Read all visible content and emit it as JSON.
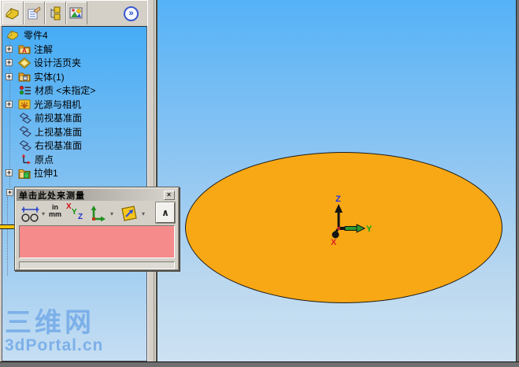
{
  "icons": {
    "plus": "+",
    "close": "×",
    "collapse": "∧",
    "overflow": "»",
    "dropdown": "▾"
  },
  "feature_tree": {
    "tab_icons": [
      "featuremanager-tree-icon",
      "propertymanager-icon",
      "configurationmanager-icon",
      "third-party-icon"
    ],
    "root_label": "零件4",
    "items": [
      {
        "label": "注解",
        "icon": "annotations-folder-icon",
        "expandable": true
      },
      {
        "label": "设计活页夹",
        "icon": "design-binder-icon",
        "expandable": true
      },
      {
        "label": "实体(1)",
        "icon": "solid-bodies-folder-icon",
        "expandable": true
      },
      {
        "label": "材质 <未指定>",
        "icon": "material-icon",
        "expandable": false
      },
      {
        "label": "光源与相机",
        "icon": "lights-cameras-icon",
        "expandable": true
      },
      {
        "label": "前视基准面",
        "icon": "plane-icon",
        "expandable": false
      },
      {
        "label": "上视基准面",
        "icon": "plane-icon",
        "expandable": false
      },
      {
        "label": "右视基准面",
        "icon": "plane-icon",
        "expandable": false
      },
      {
        "label": "原点",
        "icon": "origin-icon",
        "expandable": false
      },
      {
        "label": "拉伸1",
        "icon": "extrude-feature-icon",
        "expandable": true
      }
    ]
  },
  "measure_dialog": {
    "title": "单击此处来测量",
    "units": {
      "line1": "in",
      "line2": "mm"
    },
    "axis_letters": {
      "x": "X",
      "y": "Y",
      "z": "Z"
    },
    "toolbar_icons": [
      "measure-calipers-icon",
      "units-in-mm-icon",
      "xyz-icon",
      "coordinate-system-icon",
      "projection-icon"
    ],
    "result_area_color": "#F58B8B"
  },
  "viewport": {
    "background_top": "#55B2F7",
    "background_bottom": "#CDE2F3",
    "part_color": "#F8A814",
    "triad": {
      "x": "X",
      "y": "Y",
      "z": "Z"
    }
  },
  "watermark": {
    "line1": "三维网",
    "line2": "3dPortal.cn",
    "color": "#7DB0E9"
  }
}
